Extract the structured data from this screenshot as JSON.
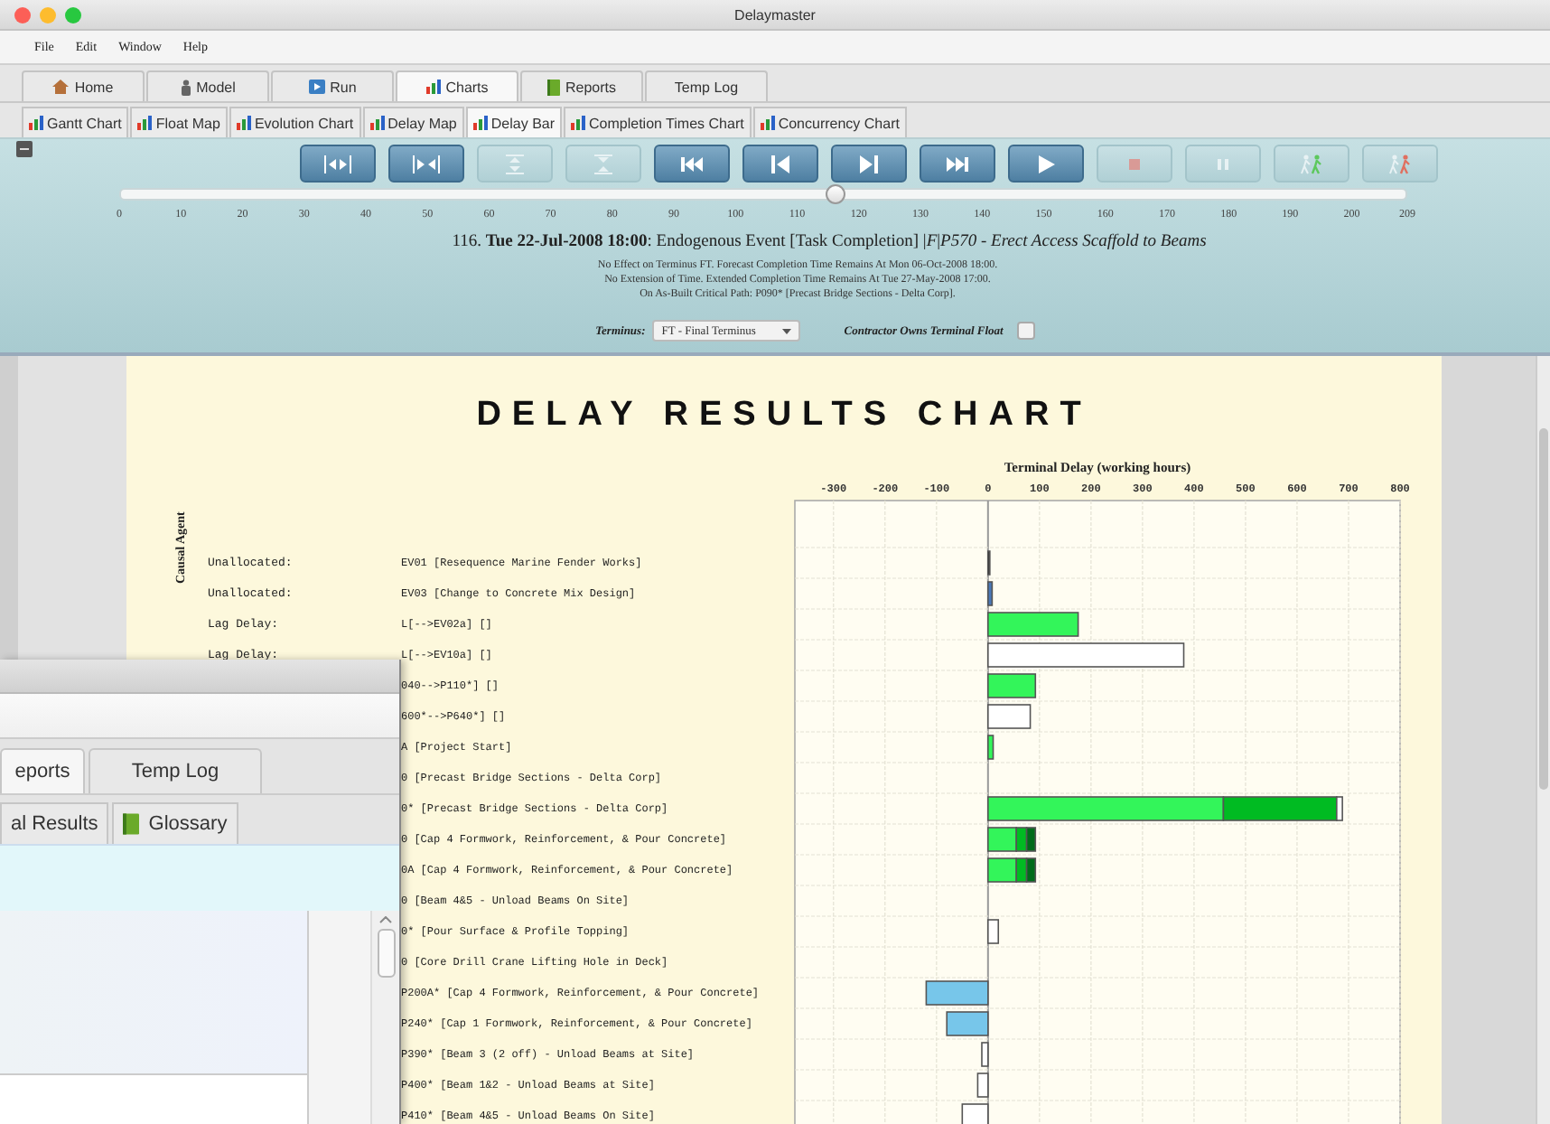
{
  "window": {
    "title": "Delaymaster"
  },
  "menu": [
    "File",
    "Edit",
    "Window",
    "Help"
  ],
  "tabs": [
    {
      "label": "Home",
      "selected": false
    },
    {
      "label": "Model",
      "selected": false
    },
    {
      "label": "Run",
      "selected": false
    },
    {
      "label": "Charts",
      "selected": true
    },
    {
      "label": "Reports",
      "selected": false
    },
    {
      "label": "Temp Log",
      "selected": false
    }
  ],
  "chart_tabs": [
    {
      "label": "Gantt Chart",
      "selected": false
    },
    {
      "label": "Float Map",
      "selected": false
    },
    {
      "label": "Evolution Chart",
      "selected": false
    },
    {
      "label": "Delay Map",
      "selected": false
    },
    {
      "label": "Delay Bar",
      "selected": true
    },
    {
      "label": "Completion Times Chart",
      "selected": false
    },
    {
      "label": "Concurrency Chart",
      "selected": false
    }
  ],
  "player": {
    "buttons": [
      {
        "kind": "expand-x",
        "disabled": false
      },
      {
        "kind": "contract-x",
        "disabled": false
      },
      {
        "kind": "expand-y",
        "disabled": true
      },
      {
        "kind": "contract-y",
        "disabled": true
      },
      {
        "kind": "first",
        "disabled": false
      },
      {
        "kind": "previous",
        "disabled": false
      },
      {
        "kind": "next",
        "disabled": false
      },
      {
        "kind": "last",
        "disabled": false
      },
      {
        "kind": "play",
        "disabled": false
      },
      {
        "kind": "stop",
        "disabled": true
      },
      {
        "kind": "pause",
        "disabled": true
      },
      {
        "kind": "walk-forward",
        "disabled": true
      },
      {
        "kind": "walk-back",
        "disabled": true
      }
    ],
    "slider": {
      "level": 0.555,
      "ticks": [
        "0",
        "10",
        "20",
        "30",
        "40",
        "50",
        "60",
        "70",
        "80",
        "90",
        "100",
        "110",
        "120",
        "130",
        "140",
        "150",
        "160",
        "170",
        "180",
        "190",
        "200",
        "209"
      ]
    }
  },
  "event": "116. **Tue 22-Jul-2008 18:00**: Endogenous Event [Task Completion] |*F*|*P570 - Erect Access Scaffold to Beams*",
  "notes": [
    "No Effect on Terminus FT. Forecast Completion Time Remains At Mon 06-Oct-2008 18:00.",
    "No Extension of Time. Extended Completion Time Remains At Tue 27-May-2008 17:00.",
    "On As-Built Critical Path: P090* [Precast Bridge Sections - Delta Corp]."
  ],
  "terminus": {
    "label": "Terminus:",
    "value": "FT - Final Terminus"
  },
  "terminal_float": {
    "label": "Contractor Owns Terminal Float",
    "checked": false
  },
  "report": {
    "title": "DELAY RESULTS CHART",
    "axis_label": "Causal Agent",
    "agents": [
      "Unallocated:",
      "Unallocated:",
      "Lag Delay:",
      "Lag Delay:"
    ],
    "chart_data": {
      "type": "bar",
      "orientation": "horizontal",
      "stacked": true,
      "xlabel": "Terminal Delay (working hours)",
      "categories": [
        "EV01 [Resequence Marine Fender Works]",
        "EV03 [Change to Concrete Mix Design]",
        "L[-->EV02a] []",
        "L[-->EV10a] []",
        "040-->P110*] []",
        "600*-->P640*] []",
        "A [Project Start]",
        "0 [Precast Bridge Sections - Delta Corp]",
        "0* [Precast Bridge Sections - Delta Corp]",
        "0 [Cap 4 Formwork, Reinforcement, & Pour Concrete]",
        "0A [Cap 4 Formwork, Reinforcement, & Pour Concrete]",
        "0 [Beam 4&5 - Unload Beams On Site]",
        "0* [Pour Surface & Profile Topping]",
        "0 [Core Drill Crane Lifting Hole in Deck]",
        "P200A* [Cap 4 Formwork, Reinforcement, & Pour Concrete]",
        "P240* [Cap 1 Formwork, Reinforcement, & Pour Concrete]",
        "P390* [Beam 3 (2 off) - Unload Beams at Site]",
        "P400* [Beam 1&2 - Unload Beams at Site]",
        "P410* [Beam 4&5 - Unload Beams On Site]"
      ],
      "xlim": [
        -375,
        800
      ],
      "grid": true,
      "xticks": [
        -300,
        -200,
        -100,
        0,
        100,
        200,
        300,
        400,
        500,
        600,
        700,
        800
      ],
      "series": [
        {
          "color": "#33f55a",
          "values": [
            0,
            0,
            175,
            0,
            92,
            0,
            10,
            0,
            457,
            55,
            55,
            0,
            0,
            0,
            0,
            0,
            0,
            0,
            0
          ]
        },
        {
          "color": "#00bb22",
          "values": [
            0,
            0,
            0,
            0,
            0,
            0,
            0,
            0,
            220,
            20,
            20,
            0,
            0,
            0,
            0,
            0,
            0,
            0,
            0
          ]
        },
        {
          "color": "#006b1a",
          "values": [
            0,
            0,
            0,
            0,
            0,
            0,
            0,
            0,
            0,
            17,
            17,
            0,
            0,
            0,
            0,
            0,
            0,
            0,
            0
          ]
        },
        {
          "color": "#ffffff",
          "values": [
            0,
            0,
            0,
            380,
            0,
            82,
            0,
            0,
            11,
            0,
            0,
            0,
            20,
            0,
            0,
            0,
            -12,
            -20,
            -50
          ]
        },
        {
          "color": "#4a78b8",
          "values": [
            0,
            8,
            0,
            0,
            0,
            0,
            0,
            0,
            0,
            0,
            0,
            0,
            0,
            0,
            0,
            0,
            0,
            0,
            0
          ]
        },
        {
          "color": "#77c6ea",
          "values": [
            0,
            0,
            0,
            0,
            0,
            0,
            0,
            0,
            0,
            0,
            0,
            0,
            0,
            0,
            -120,
            -80,
            0,
            0,
            0
          ]
        },
        {
          "color": "#222222",
          "values": [
            2,
            0,
            0,
            0,
            0,
            0,
            0,
            0,
            0,
            0,
            0,
            0,
            0,
            0,
            0,
            0,
            0,
            0,
            0
          ]
        }
      ]
    }
  },
  "back_window": {
    "tabs": [
      {
        "label": "eports",
        "selected": true
      },
      {
        "label": "Temp Log",
        "selected": false
      }
    ],
    "sub_tabs": [
      {
        "label": "al Results",
        "selected": false
      },
      {
        "label": "Glossary",
        "selected": false
      }
    ]
  }
}
